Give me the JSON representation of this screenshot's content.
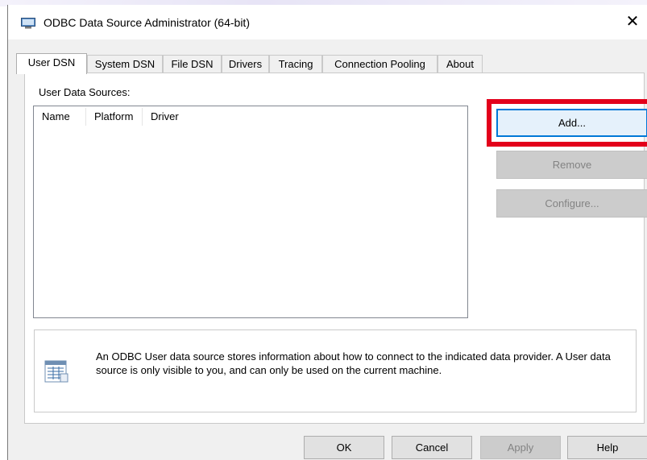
{
  "window": {
    "title": "ODBC Data Source Administrator (64-bit)",
    "close_glyph": "✕"
  },
  "tabs": [
    {
      "label": "User DSN",
      "active": true
    },
    {
      "label": "System DSN",
      "active": false
    },
    {
      "label": "File DSN",
      "active": false
    },
    {
      "label": "Drivers",
      "active": false
    },
    {
      "label": "Tracing",
      "active": false
    },
    {
      "label": "Connection Pooling",
      "active": false
    },
    {
      "label": "About",
      "active": false
    }
  ],
  "panel": {
    "group_label": "User Data Sources:",
    "columns": [
      "Name",
      "Platform",
      "Driver"
    ],
    "rows": []
  },
  "side_buttons": {
    "add": "Add...",
    "remove": "Remove",
    "configure": "Configure..."
  },
  "info": {
    "text": "An ODBC User data source stores information about how to connect to the indicated data provider.  A User data source is only visible to you, and can only be used on the current machine.",
    "icon": "data-source-icon"
  },
  "bottom_buttons": {
    "ok": "OK",
    "cancel": "Cancel",
    "apply": "Apply",
    "help": "Help"
  },
  "colors": {
    "highlight": "#e3001b",
    "focus": "#0078d7"
  }
}
